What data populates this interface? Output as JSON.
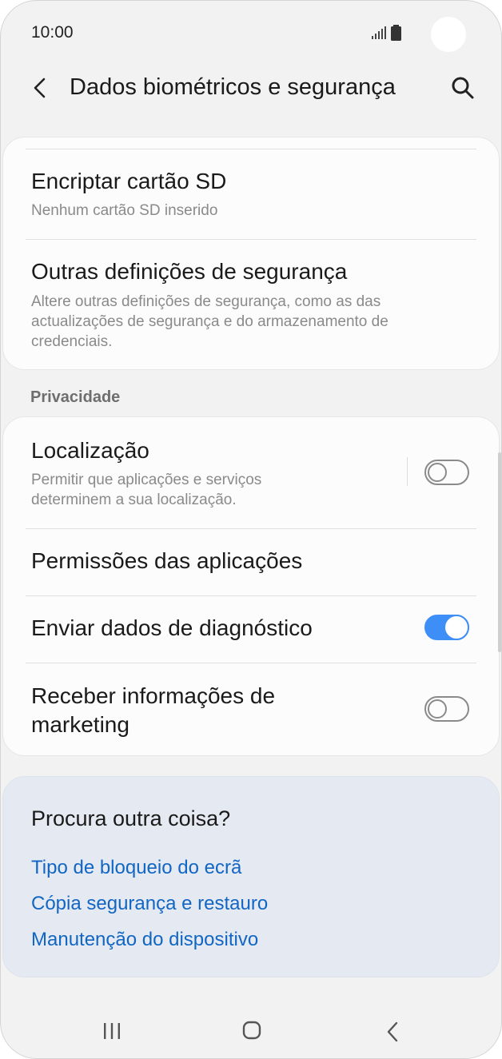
{
  "status_bar": {
    "time": "10:00",
    "icons": [
      "signal-icon",
      "battery-icon"
    ]
  },
  "app_bar": {
    "title": "Dados biométricos e segurança",
    "icons": [
      "back-icon",
      "search-icon"
    ]
  },
  "security_card": {
    "items": [
      {
        "title": "Encriptar cartão SD",
        "subtitle": "Nenhum cartão SD inserido"
      },
      {
        "title": "Outras definições de segurança",
        "subtitle": "Altere outras definições de segurança, como as das actualizações de segurança e do armazenamento de credenciais."
      }
    ]
  },
  "privacy": {
    "header": "Privacidade",
    "items": [
      {
        "title": "Localização",
        "subtitle": "Permitir que aplicações e serviços determinem a sua localização.",
        "toggle": false
      },
      {
        "title": "Permissões das aplicações"
      },
      {
        "title": "Enviar dados de diagnóstico",
        "toggle": true
      },
      {
        "title": "Receber informações de marketing",
        "toggle": false
      }
    ]
  },
  "suggestions": {
    "title": "Procura outra coisa?",
    "links": [
      "Tipo de bloqueio do ecrã",
      "Cópia segurança e restauro",
      "Manutenção do dispositivo"
    ]
  },
  "nav_bar": {
    "icons": [
      "recents-icon",
      "home-icon",
      "back-icon"
    ]
  },
  "colors": {
    "accent": "#3e8ef7",
    "link": "#1266c3",
    "background": "#f2f2f2",
    "card": "#fcfcfc",
    "suggest_card": "#e5eaf2"
  }
}
